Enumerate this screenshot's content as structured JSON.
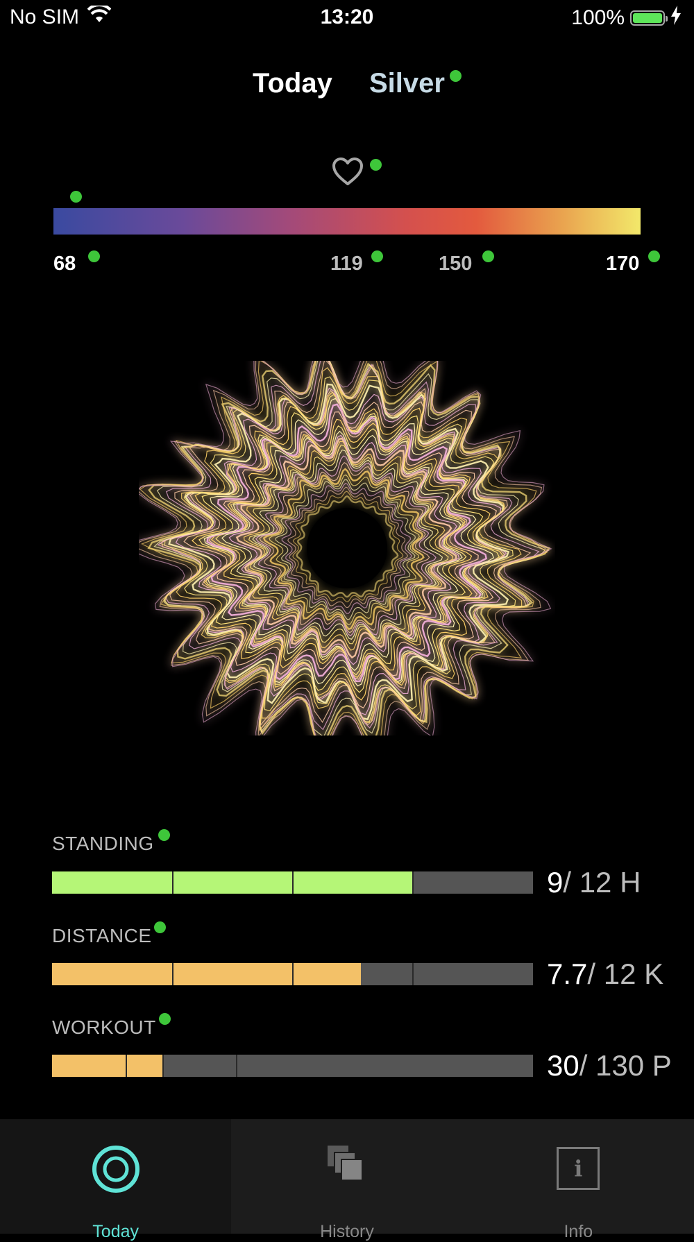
{
  "status_bar": {
    "carrier": "No SIM",
    "time": "13:20",
    "battery": "100%"
  },
  "header": {
    "tab_today": "Today",
    "tab_silver": "Silver"
  },
  "heart_rate": {
    "labels": [
      "68",
      "119",
      "150",
      "170"
    ]
  },
  "metrics": [
    {
      "label": "STANDING",
      "value": "9",
      "target": "/ 12 H",
      "progress": 0.75,
      "color": "#b5f677"
    },
    {
      "label": "DISTANCE",
      "value": "7.7",
      "target": "/ 12 K",
      "progress": 0.642,
      "color": "#f3c168"
    },
    {
      "label": "WORKOUT",
      "value": "30",
      "target": "/ 130 P",
      "progress": 0.231,
      "color": "#f3c168"
    }
  ],
  "tabbar": {
    "today": "Today",
    "history": "History",
    "info": "Info",
    "info_icon_glyph": "i"
  },
  "colors": {
    "active_tab": "#5fe3d6",
    "status_dot": "#3ec63a",
    "standing": "#b5f677",
    "distance": "#f3c168",
    "workout": "#f3c168"
  }
}
